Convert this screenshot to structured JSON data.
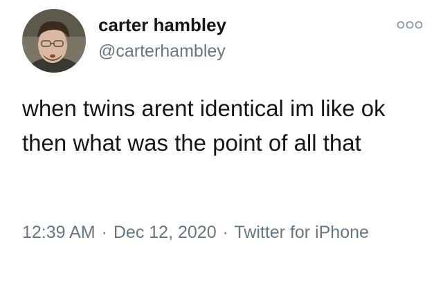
{
  "user": {
    "display_name": "carter hambley",
    "handle": "@carterhambley"
  },
  "tweet": {
    "text": "when twins arent identical im like ok then what was the point of all that"
  },
  "meta": {
    "time": "12:39 AM",
    "separator": "·",
    "date": "Dec 12, 2020",
    "source": "Twitter for iPhone"
  },
  "icons": {
    "more": "more-options-icon",
    "avatar": "user-avatar-photo"
  },
  "colors": {
    "text": "#14171a",
    "secondary": "#657786",
    "background": "#ffffff"
  }
}
